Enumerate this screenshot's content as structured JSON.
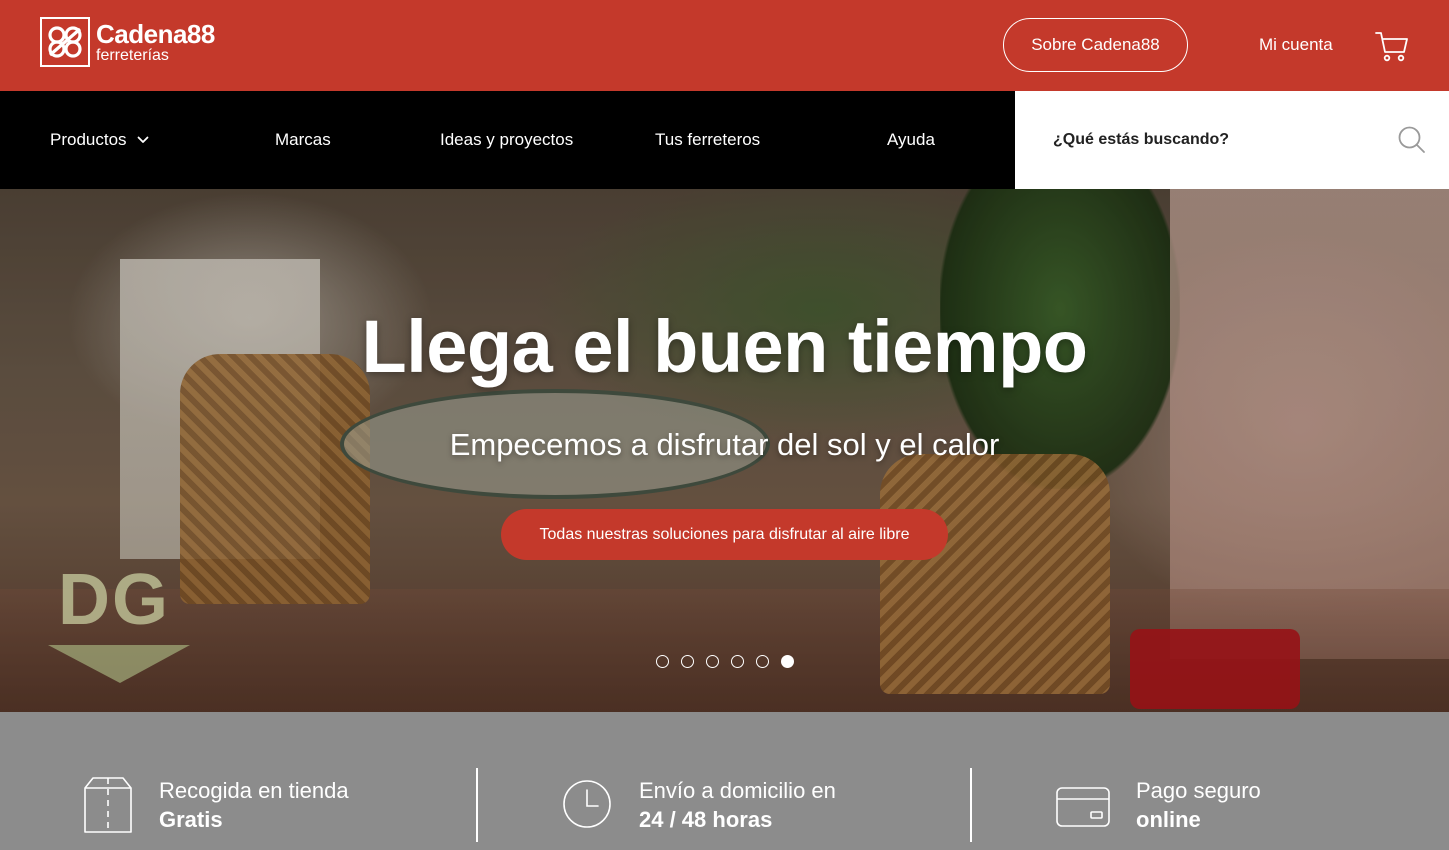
{
  "brand": {
    "name": "Cadena88",
    "tagline": "ferreterías",
    "mark": "88",
    "color": "#c4392b"
  },
  "header": {
    "about_button": "Sobre Cadena88",
    "account_link": "Mi cuenta",
    "cart_icon": "cart-icon"
  },
  "nav": {
    "items": [
      {
        "label": "Productos",
        "has_dropdown": true
      },
      {
        "label": "Marcas"
      },
      {
        "label": "Ideas y proyectos"
      },
      {
        "label": "Tus ferreteros"
      },
      {
        "label": "Ayuda"
      }
    ]
  },
  "search": {
    "placeholder": "¿Qué estás buscando?",
    "icon": "search-icon"
  },
  "hero": {
    "title": "Llega el buen tiempo",
    "subtitle": "Empecemos a disfrutar del sol y el calor",
    "cta": "Todas nuestras soluciones para disfrutar al aire libre",
    "slides": 6,
    "active_slide": 6
  },
  "watermark": {
    "text": "DG"
  },
  "features": [
    {
      "icon": "box-icon",
      "line1": "Recogida en tienda",
      "line2": "Gratis"
    },
    {
      "icon": "clock-icon",
      "line1": "Envío a domicilio en",
      "line2": "24 / 48 horas"
    },
    {
      "icon": "credit-card-icon",
      "line1": "Pago seguro",
      "line2": "online"
    }
  ]
}
